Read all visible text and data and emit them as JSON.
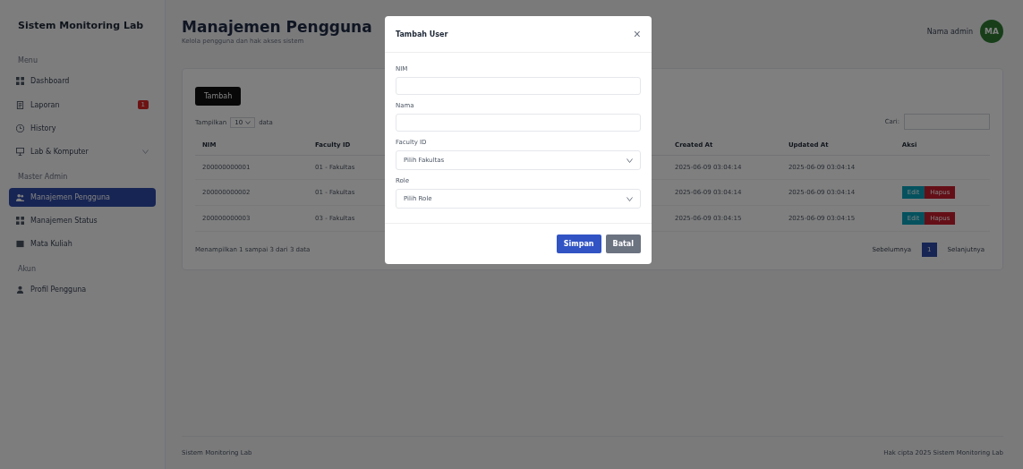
{
  "sidebar": {
    "brand": "Sistem Monitoring Lab",
    "sections": [
      {
        "heading": "Menu",
        "items": [
          {
            "label": "Dashboard",
            "selected": false
          },
          {
            "label": "Laporan",
            "selected": false,
            "badge": "1"
          },
          {
            "label": "History",
            "selected": false
          },
          {
            "label": "Lab & Komputer",
            "selected": false,
            "expanded": false
          }
        ]
      },
      {
        "heading": "Master Admin",
        "items": [
          {
            "label": "Manajemen Pengguna",
            "selected": true
          },
          {
            "label": "Manajemen Status",
            "selected": false
          },
          {
            "label": "Mata Kuliah",
            "selected": false
          }
        ]
      },
      {
        "heading": "Akun",
        "items": [
          {
            "label": "Profil Pengguna",
            "selected": false
          }
        ]
      }
    ]
  },
  "header": {
    "title": "Manajemen Pengguna",
    "subtitle": "Kelola pengguna dan hak akses sistem",
    "user_name": "Nama admin",
    "avatar": "MA"
  },
  "card": {
    "add_button": "Tambah",
    "show_label": "Tampilkan",
    "page_size": "10",
    "show_suffix": "data",
    "search_label": "Cari:",
    "table": {
      "columns": [
        "NIM",
        "Faculty ID",
        "Created At",
        "Updated At",
        "Aksi"
      ],
      "rows": [
        {
          "nim": "200000000001",
          "faculty": "01 - Fakultas",
          "created": "2025-06-09 03:04:14",
          "updated": "2025-06-09 03:04:14",
          "actions": []
        },
        {
          "nim": "200000000002",
          "faculty": "01 - Fakultas",
          "created": "2025-06-09 03:04:14",
          "updated": "2025-06-09 03:04:14",
          "actions": [
            {
              "label": "Edit",
              "kind": "edit"
            },
            {
              "label": "Hapus",
              "kind": "delete"
            }
          ]
        },
        {
          "nim": "200000000003",
          "faculty": "03 - Fakultas",
          "created": "2025-06-09 03:04:15",
          "updated": "2025-06-09 03:04:15",
          "actions": [
            {
              "label": "Edit",
              "kind": "edit"
            },
            {
              "label": "Hapus",
              "kind": "delete"
            }
          ]
        }
      ]
    },
    "info": "Menampilkan 1 sampai 3 dari 3 data",
    "pagination": {
      "previous": "Sebelumnya",
      "pages": [
        {
          "label": "1",
          "selected": true
        }
      ],
      "next": "Selanjutnya"
    }
  },
  "footer": {
    "left": "Sistem Monitoring Lab",
    "right": "Hak cipta 2025 Sistem Monitoring Lab"
  },
  "modal": {
    "title": "Tambah User",
    "close": "×",
    "fields": [
      {
        "kind": "input",
        "label": "NIM"
      },
      {
        "kind": "input",
        "label": "Nama"
      },
      {
        "kind": "select",
        "label": "Faculty ID",
        "value": "Pilih Fakultas"
      },
      {
        "kind": "select",
        "label": "Role",
        "value": "Pilih Role"
      }
    ],
    "buttons": [
      {
        "label": "Simpan",
        "kind": "primary"
      },
      {
        "label": "Batal",
        "kind": "secondary"
      }
    ]
  }
}
